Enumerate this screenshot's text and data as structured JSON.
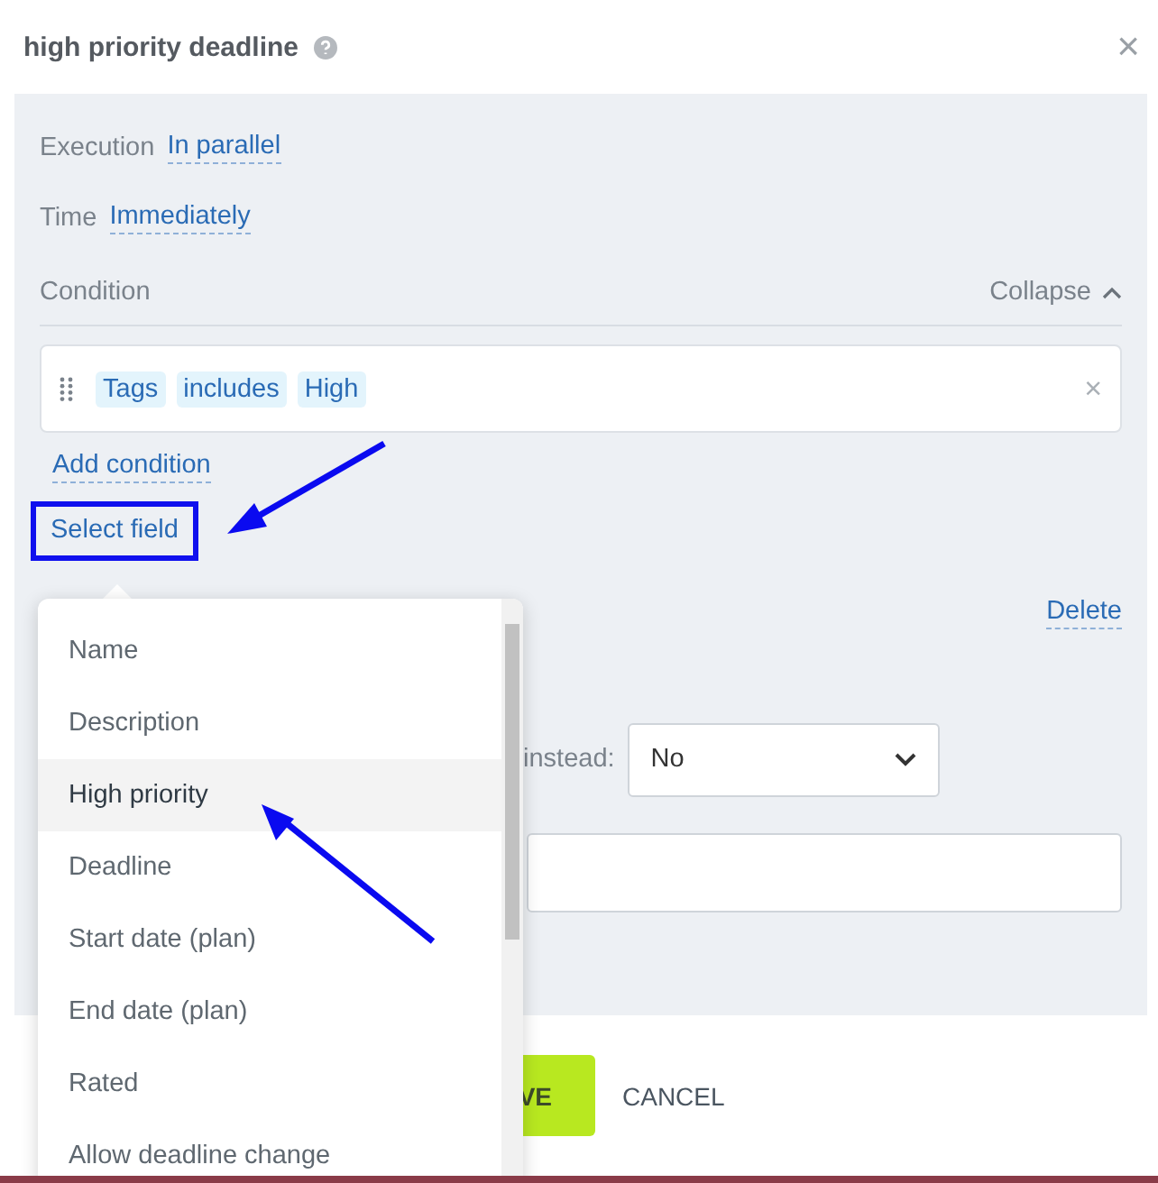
{
  "dialog": {
    "title": "high priority deadline",
    "close": "×"
  },
  "execution": {
    "label": "Execution",
    "value": "In parallel"
  },
  "time": {
    "label": "Time",
    "value": "Immediately"
  },
  "condition": {
    "label": "Condition",
    "collapse": "Collapse",
    "chips": [
      "Tags",
      "includes",
      "High"
    ],
    "remove": "×",
    "add": "Add condition"
  },
  "select_field": "Select field",
  "delete": "Delete",
  "instead": {
    "label": "instead:",
    "value": "No"
  },
  "footer": {
    "save": "VE",
    "cancel": "CANCEL"
  },
  "dropdown": {
    "items": [
      {
        "label": "Name",
        "selected": false
      },
      {
        "label": "Description",
        "selected": false
      },
      {
        "label": "High priority",
        "selected": true
      },
      {
        "label": "Deadline",
        "selected": false
      },
      {
        "label": "Start date (plan)",
        "selected": false
      },
      {
        "label": "End date (plan)",
        "selected": false
      },
      {
        "label": "Rated",
        "selected": false
      },
      {
        "label": "Allow deadline change",
        "selected": false
      }
    ]
  }
}
